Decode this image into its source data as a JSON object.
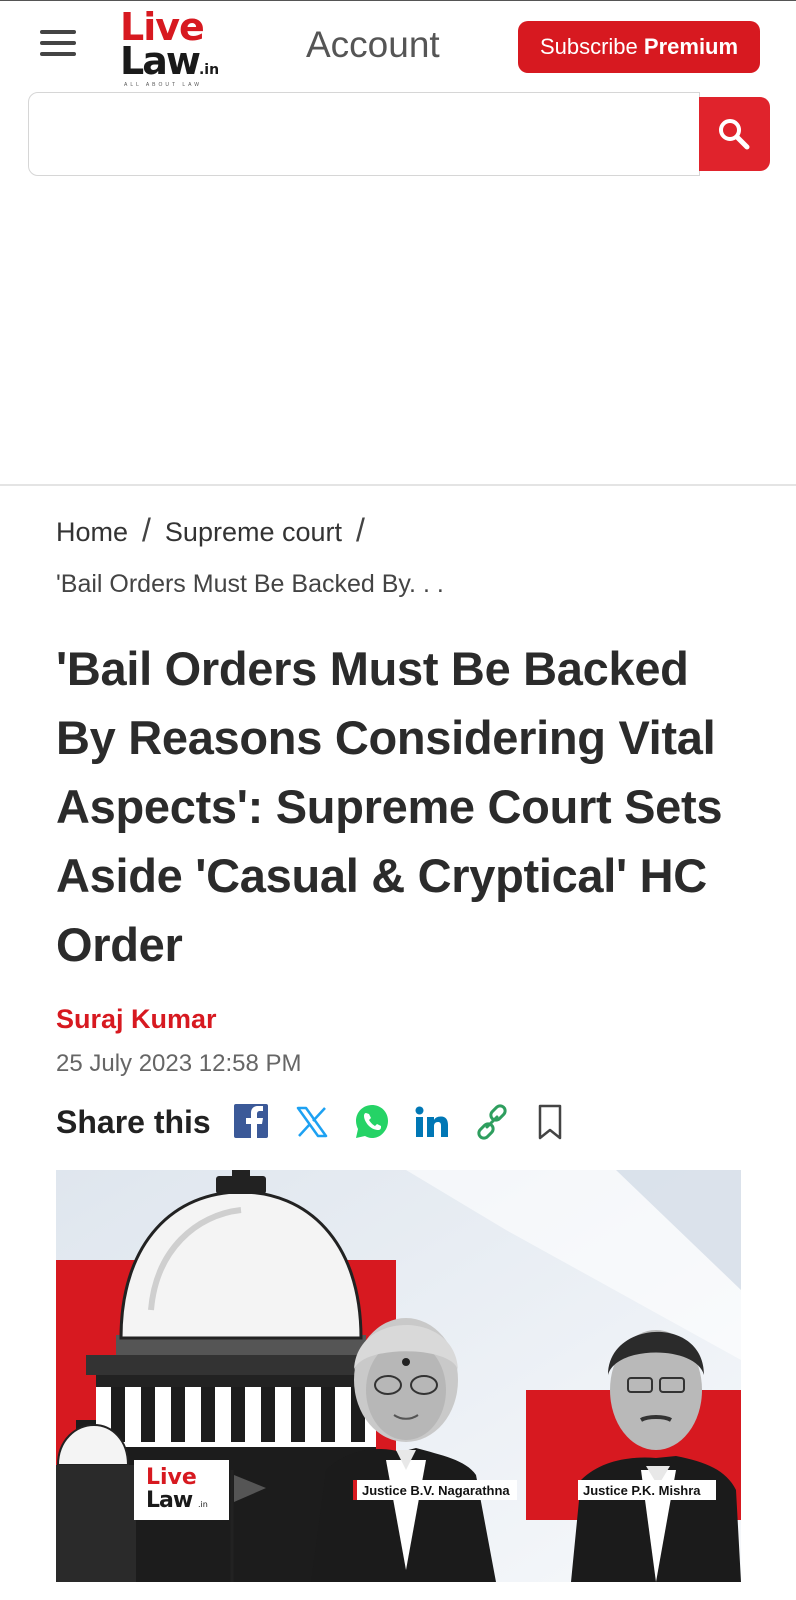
{
  "header": {
    "logo_line1": "Live",
    "logo_line2": "Law",
    "logo_tld": ".in",
    "logo_tagline": "ALL ABOUT LAW",
    "account_label": "Account",
    "subscribe_prefix": "Subscribe",
    "subscribe_strong": "Premium"
  },
  "search": {
    "placeholder": "",
    "value": ""
  },
  "breadcrumb": {
    "home": "Home",
    "section": "Supreme court",
    "current": "'Bail Orders Must Be Backed By. . ."
  },
  "article": {
    "title": "'Bail Orders Must Be Backed By Reasons Considering Vital Aspects': Supreme Court Sets Aside 'Casual & Cryptical' HC Order",
    "author": "Suraj Kumar",
    "date": "25 July 2023 12:58 PM"
  },
  "share": {
    "label": "Share this",
    "icons": [
      "facebook-icon",
      "x-icon",
      "whatsapp-icon",
      "linkedin-icon",
      "link-icon",
      "bookmark-icon"
    ]
  },
  "hero_image": {
    "logo_line1": "Live",
    "logo_line2": "Law",
    "logo_tld": ".in",
    "caption_left": "Justice B.V. Nagarathna",
    "caption_right": "Justice P.K. Mishra"
  },
  "colors": {
    "brand_red": "#d71920",
    "search_red": "#e0232c",
    "facebook": "#3b5998",
    "x": "#1da1f2",
    "whatsapp": "#25d366",
    "linkedin": "#0077b5",
    "link": "#2e9e5e"
  }
}
